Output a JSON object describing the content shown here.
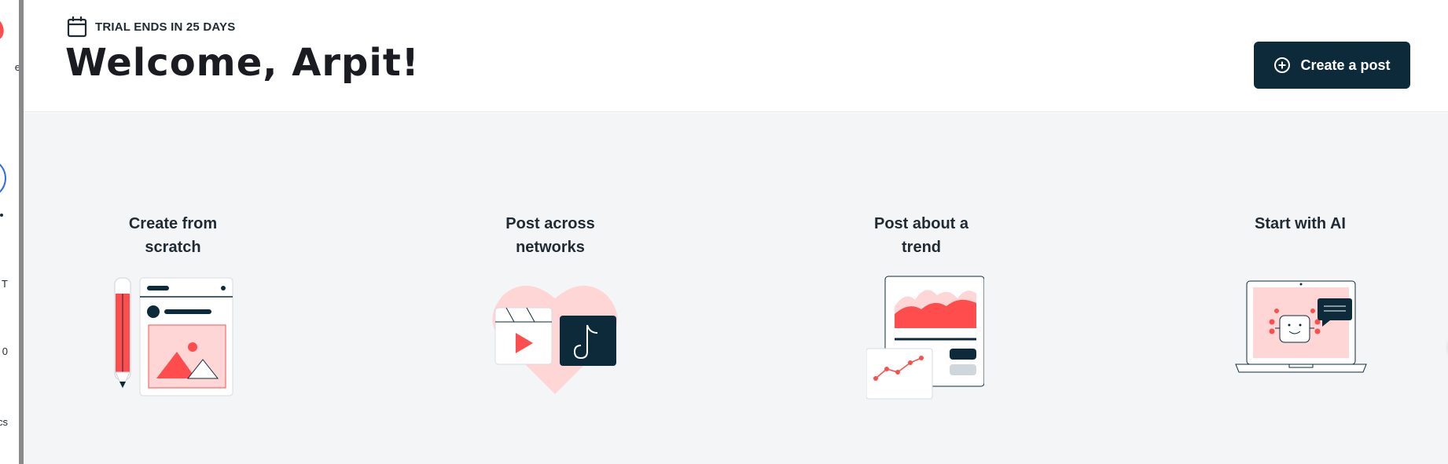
{
  "sidebar": {
    "partial_labels": [
      "e",
      "T",
      "0",
      "cs"
    ]
  },
  "header": {
    "trial_text": "TRIAL ENDS IN 25 DAYS",
    "welcome": "Welcome, Arpit!",
    "create_post_label": "Create a post"
  },
  "options": [
    {
      "title_line1": "Create from",
      "title_line2": "scratch"
    },
    {
      "title_line1": "Post across",
      "title_line2": "networks"
    },
    {
      "title_line1": "Post about a",
      "title_line2": "trend"
    },
    {
      "title_line1": "Start with AI",
      "title_line2": ""
    }
  ],
  "colors": {
    "primary": "#0d2a3b",
    "accent": "#ff4d4d",
    "accent_light": "#ffd6d6",
    "background": "#f4f5f7"
  },
  "icons": [
    "calendar-icon",
    "plus-circle-icon",
    "sparkle-icon",
    "tiktok-icon",
    "play-icon"
  ]
}
